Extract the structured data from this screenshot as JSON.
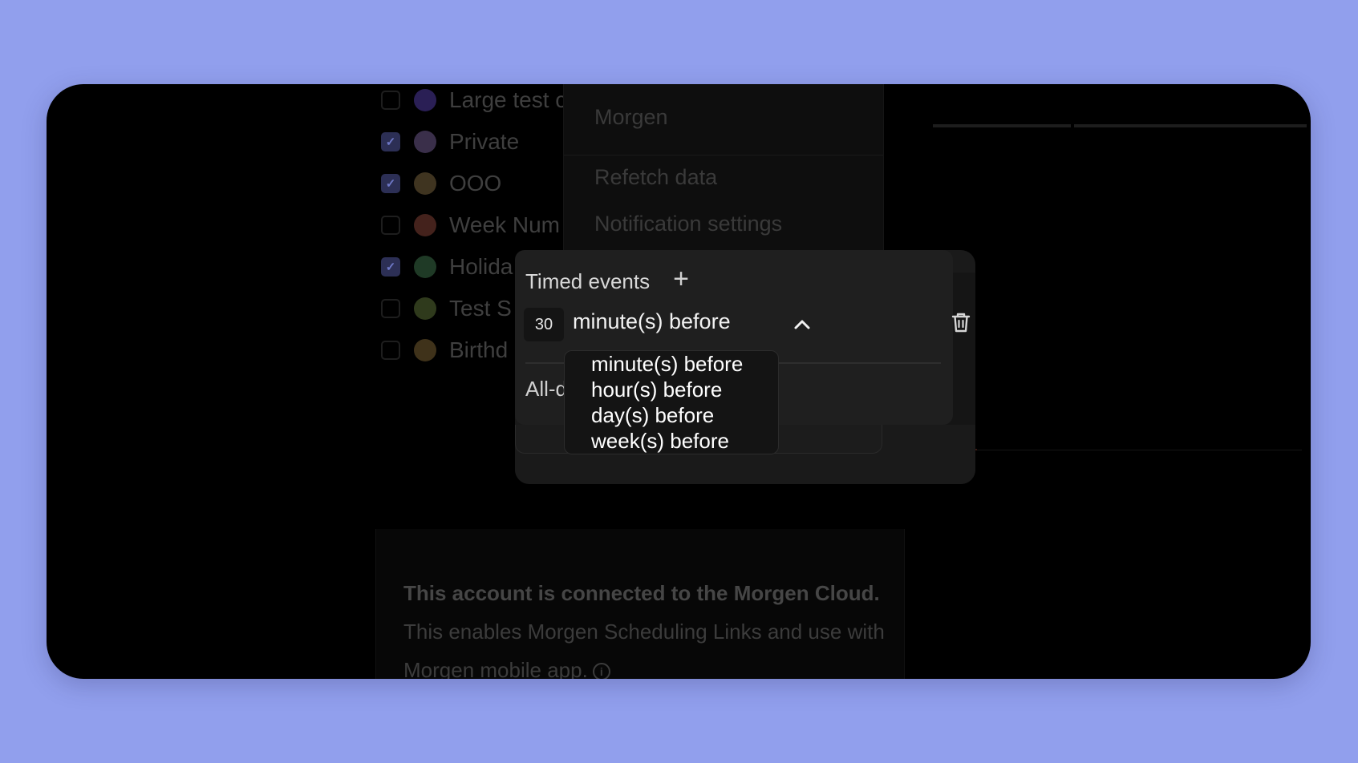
{
  "calendars": [
    {
      "name": "Large test c",
      "checked": false,
      "color": "#2a1f55"
    },
    {
      "name": "Private",
      "checked": true,
      "color": "#3a2f4a"
    },
    {
      "name": "OOO",
      "checked": true,
      "color": "#3f3420"
    },
    {
      "name": "Week Num",
      "checked": false,
      "color": "#44221c"
    },
    {
      "name": "Holida",
      "checked": true,
      "color": "#1f3a26"
    },
    {
      "name": "Test S",
      "checked": false,
      "color": "#2f3a1c"
    },
    {
      "name": "Birthd",
      "checked": false,
      "color": "#3f321a"
    }
  ],
  "menu": {
    "account": "Morgen",
    "refetch": "Refetch data",
    "notifications": "Notification settings"
  },
  "info": {
    "bold": "This account is connected to the Morgen Cloud.",
    "rest": " This enables Morgen Scheduling Links and use with Morgen mobile app."
  },
  "popover": {
    "title": "Timed events",
    "amount": "30",
    "unit_selected": "minute(s) before",
    "allday_label": "All-d"
  },
  "dropdown": {
    "options": [
      "minute(s) before",
      "hour(s) before",
      "day(s) before",
      "week(s) before"
    ]
  },
  "icons": {
    "add": "plus-icon",
    "toggle": "chevron-up-icon",
    "delete": "trash-icon",
    "info": "info-icon"
  }
}
